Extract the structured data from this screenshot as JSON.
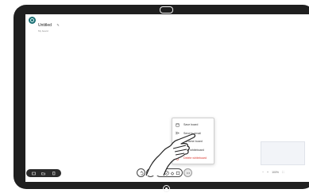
{
  "board": {
    "title": "Untitled",
    "edit_mark": "✎",
    "subtitle": "My board"
  },
  "menu": {
    "items": [
      {
        "label": "Save board",
        "icon": "save-icon"
      },
      {
        "label": "Send to email",
        "icon": "send-icon"
      },
      {
        "label": "Rename board",
        "icon": "pencil-icon"
      },
      {
        "label": "New whiteboard",
        "icon": "new-board-icon"
      },
      {
        "label": "Delete whiteboard",
        "icon": "trash-icon",
        "color": "#d9342b"
      }
    ]
  },
  "zoom": {
    "minus": "−",
    "plus": "+",
    "level": "100%",
    "fit": "⛶"
  },
  "colors": {
    "device_frame": "#1f1f1f",
    "avatar": "#1a6e73",
    "danger": "#d9342b"
  }
}
